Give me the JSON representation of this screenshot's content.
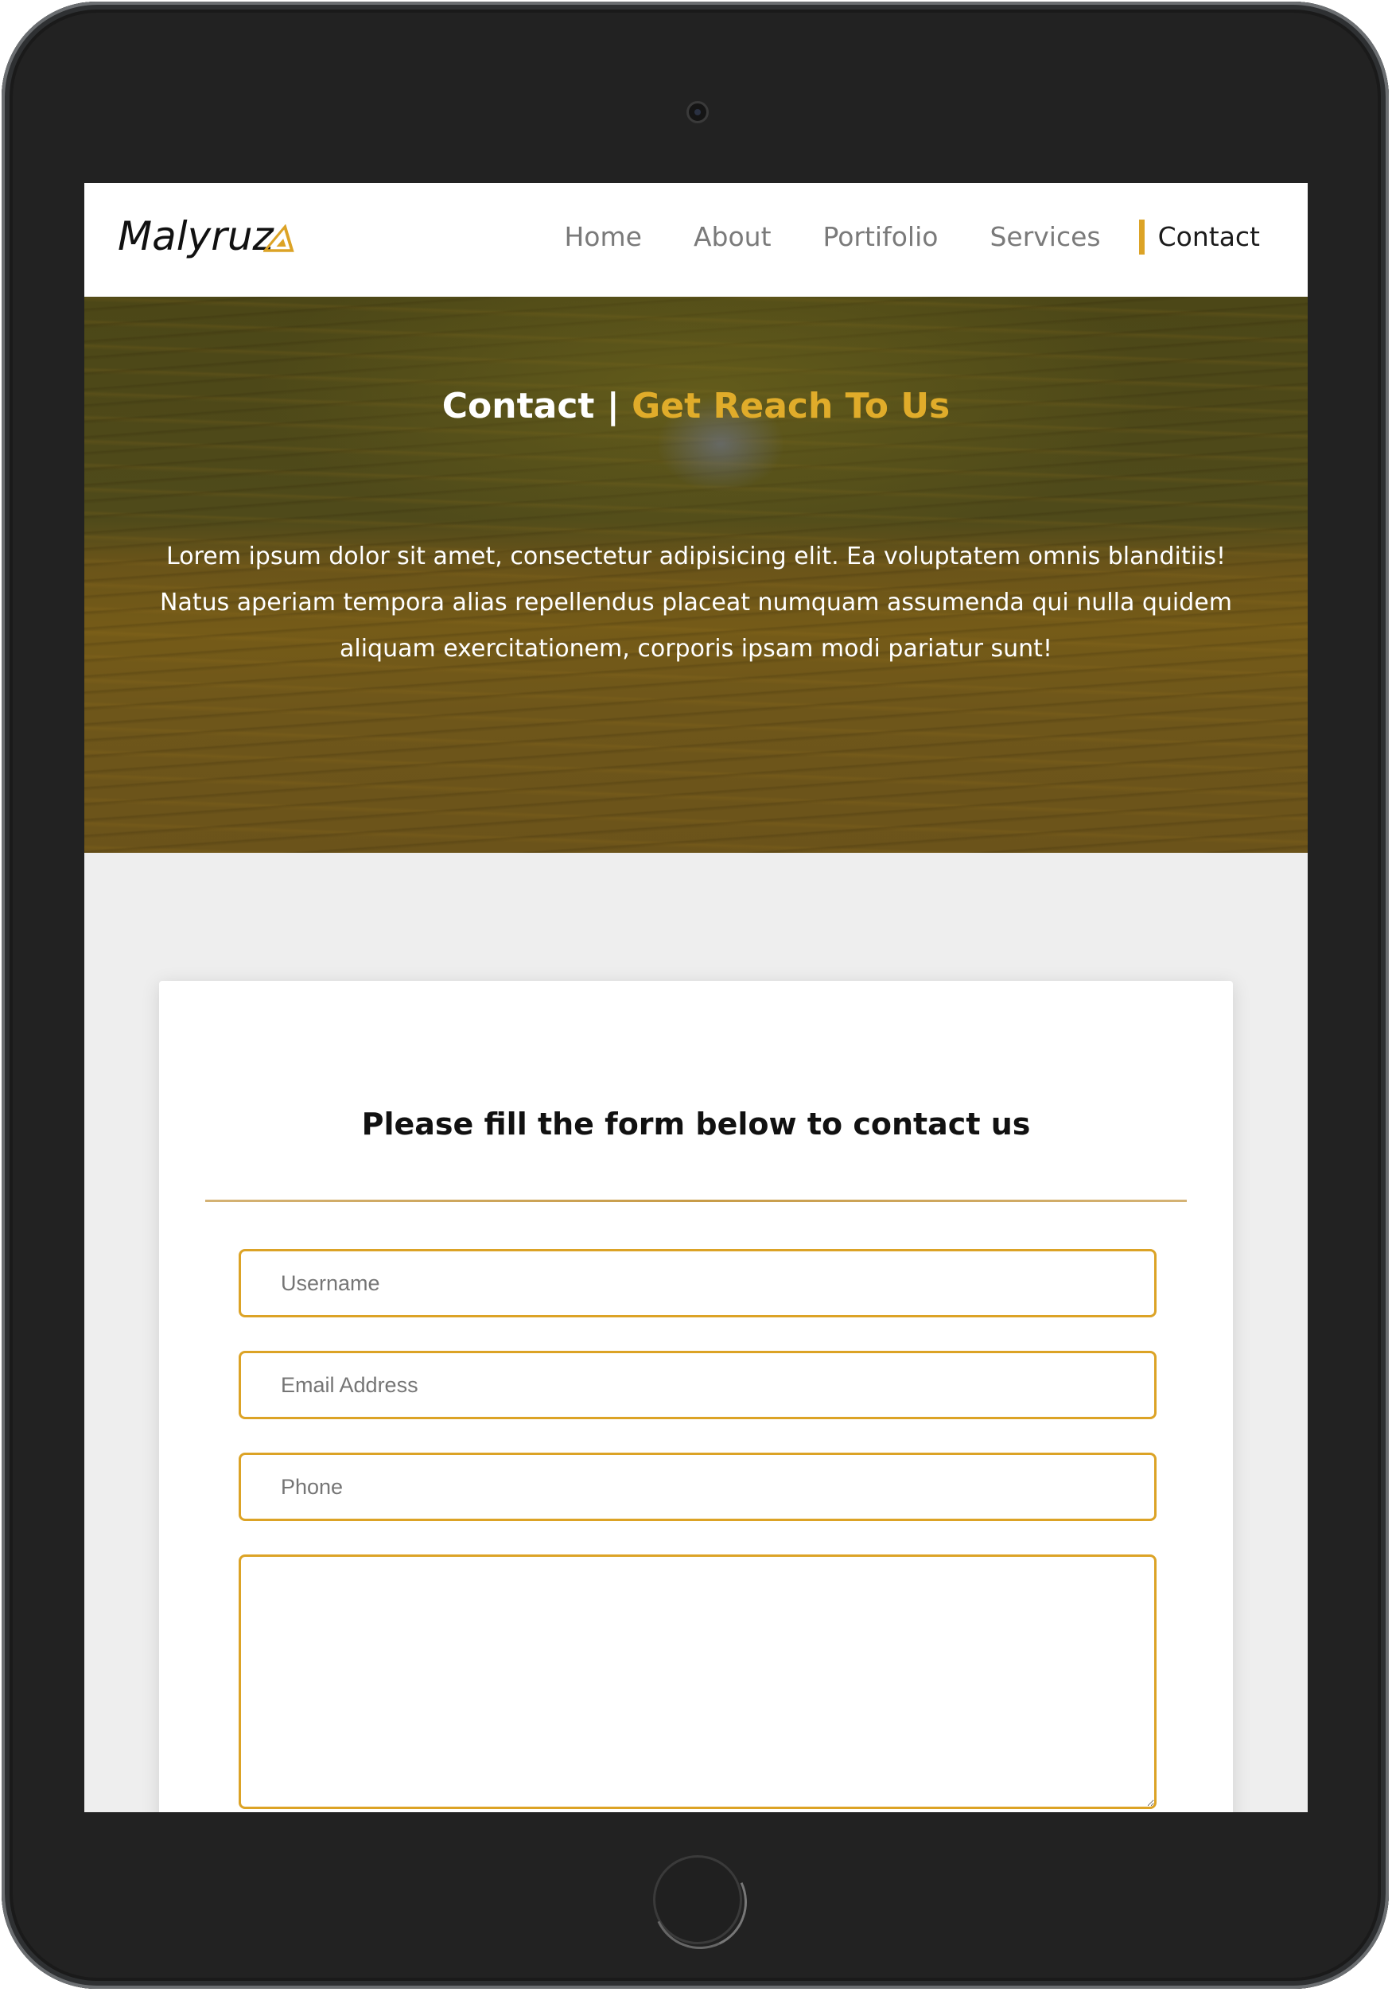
{
  "brand": {
    "name": "Malyruz",
    "accent_color": "#dca326",
    "logo_icon": "triangle-icon"
  },
  "nav": {
    "items": [
      {
        "label": "Home",
        "active": false
      },
      {
        "label": "About",
        "active": false
      },
      {
        "label": "Portifolio",
        "active": false
      },
      {
        "label": "Services",
        "active": false
      },
      {
        "label": "Contact",
        "active": true
      }
    ]
  },
  "hero": {
    "title_main": "Contact",
    "title_sep": " | ",
    "title_accent": "Get Reach To Us",
    "text": "Lorem ipsum dolor sit amet, consectetur adipisicing elit. Ea voluptatem omnis blanditiis! Natus aperiam tempora alias repellendus placeat numquam assumenda qui nulla quidem aliquam exercitationem, corporis ipsam modi pariatur sunt!"
  },
  "form": {
    "title": "Please fill the form below to contact us",
    "username_placeholder": "Username",
    "email_placeholder": "Email Address",
    "phone_placeholder": "Phone",
    "message_value": ""
  }
}
